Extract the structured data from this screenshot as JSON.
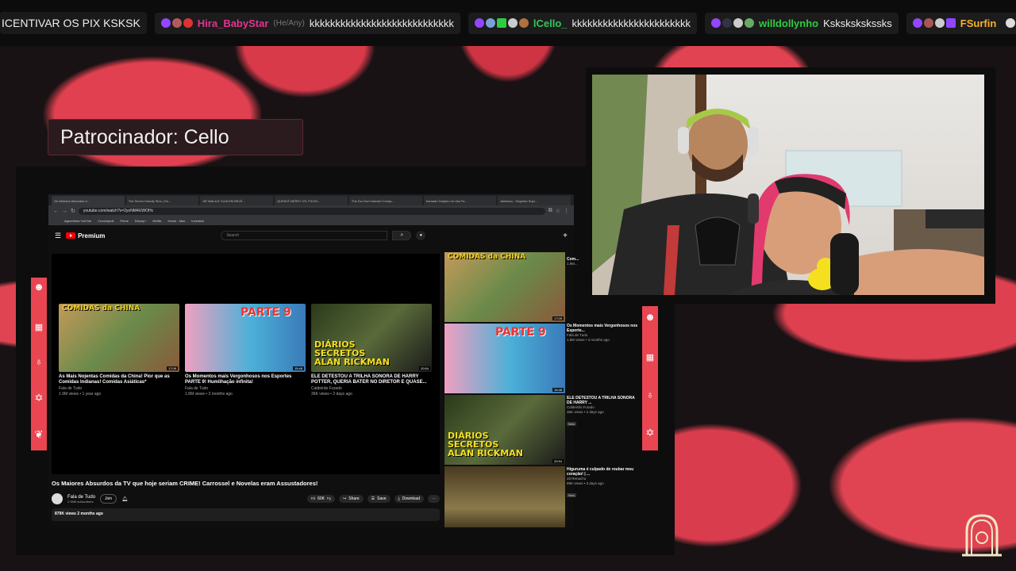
{
  "chat": [
    {
      "user": "",
      "text": "ICENTIVAR OS PIX KSKSK",
      "color": "#ffffff",
      "pronoun": ""
    },
    {
      "user": "Hira_BabyStar",
      "text": "kkkkkkkkkkkkkkkkkkkkkkkkkkkk",
      "color": "#e2358f",
      "pronoun": "(He/Any)"
    },
    {
      "user": "lCello_",
      "text": "kkkkkkkkkkkkkkkkkkkkkkk",
      "color": "#34c759",
      "pronoun": ""
    },
    {
      "user": "willdollynho",
      "text": "Kskskskskssks",
      "color": "#2ecc40",
      "pronoun": ""
    },
    {
      "user": "FSurfin",
      "text": "",
      "color": "#f5b12b",
      "pronoun": ""
    }
  ],
  "sponsor": {
    "label": "Patrocinador: Cello"
  },
  "browser": {
    "tabs": [
      "Os Maiores Absurdos d...",
      "The Seven Deadly Sins | Ho...",
      "DE MALA E CUIA EM BELÉ...",
      "QUEM É NERD? VS. FILHO...",
      "The Do-Over Damsel Consp...",
      "Kamado Tanjirou no Uta Fa...",
      "Akimaou - Segredo Supr..."
    ],
    "url": "youtube.com/watch?v=2yoNM4UWOHc",
    "bookmarks": [
      "Agendrima YuriYah",
      "Crunchyroll",
      "Prime",
      "Disney+",
      "Netflix",
      "Home - Max",
      "Incentive"
    ]
  },
  "youtube": {
    "logo": "Premium",
    "search_placeholder": "Search",
    "end_cards": [
      {
        "title": "As Mais Nojentas Comidas da China! Pior que as Comidas Indianas! Comidas Asiáticas*",
        "channel": "Fala de Tudo",
        "meta": "1.9M views • 1 year ago",
        "duration": "17:09",
        "thumb_text": "COMIDAS da CHINA"
      },
      {
        "title": "Os Momentos mais Vergonhosos nos Esportes PARTE 9! Humilhação infinita!",
        "channel": "Fala de Tudo",
        "meta": "1.8M views • 3 months ago",
        "duration": "15:48",
        "thumb_text": "PARTE 9"
      },
      {
        "title": "ELE DETESTOU A TRILHA SONORA DE HARRY POTTER, QUERIA BATER NO DIRETOR E QUASE...",
        "channel": "Caldeirão Furado",
        "meta": "36K views • 2 days ago",
        "duration": "20:54",
        "thumb_text": "DIÁRIOS SECRETOS ALAN RICKMAN"
      }
    ],
    "video_title": "Os Maiores Absurdos da TV que hoje seriam CRIME! Carrossel e Novelas eram Assustadores!",
    "channel_name": "Fala de Tudo",
    "channel_subs": "2.95M subscribers",
    "join": "Join",
    "likes": "60K",
    "share": "Share",
    "save": "Save",
    "download": "Download",
    "desc": "879K views  2 months ago",
    "sidebar": [
      {
        "title": "Com...",
        "channel": "",
        "meta": "1.9M...",
        "duration": "17:09",
        "thumb_text": "COMIDAS da CHINA",
        "new": ""
      },
      {
        "title": "Os Momentos mais Vergonhosos nos Esporte...",
        "channel": "Fala de Tudo",
        "meta": "1.8M views • 3 months ago",
        "duration": "15:48",
        "thumb_text": "PARTE 9",
        "new": ""
      },
      {
        "title": "ELE DETESTOU A TRILHA SONORA DE HARRY ...",
        "channel": "Caldeirão Furado",
        "meta": "36K views • 2 days ago",
        "duration": "20:54",
        "thumb_text": "DIÁRIOS SECRETOS ALAN RICKMAN",
        "new": "New"
      },
      {
        "title": "Higuruma é culpado de roubar meu coração! | ...",
        "channel": "28 Renacho",
        "meta": "99K views • 3 days ago",
        "duration": "",
        "thumb_text": "",
        "new": "New"
      }
    ]
  },
  "colors": {
    "accent_red": "#e94652",
    "yt_red": "#ff0000",
    "bg_dark": "#0d0d0d"
  }
}
